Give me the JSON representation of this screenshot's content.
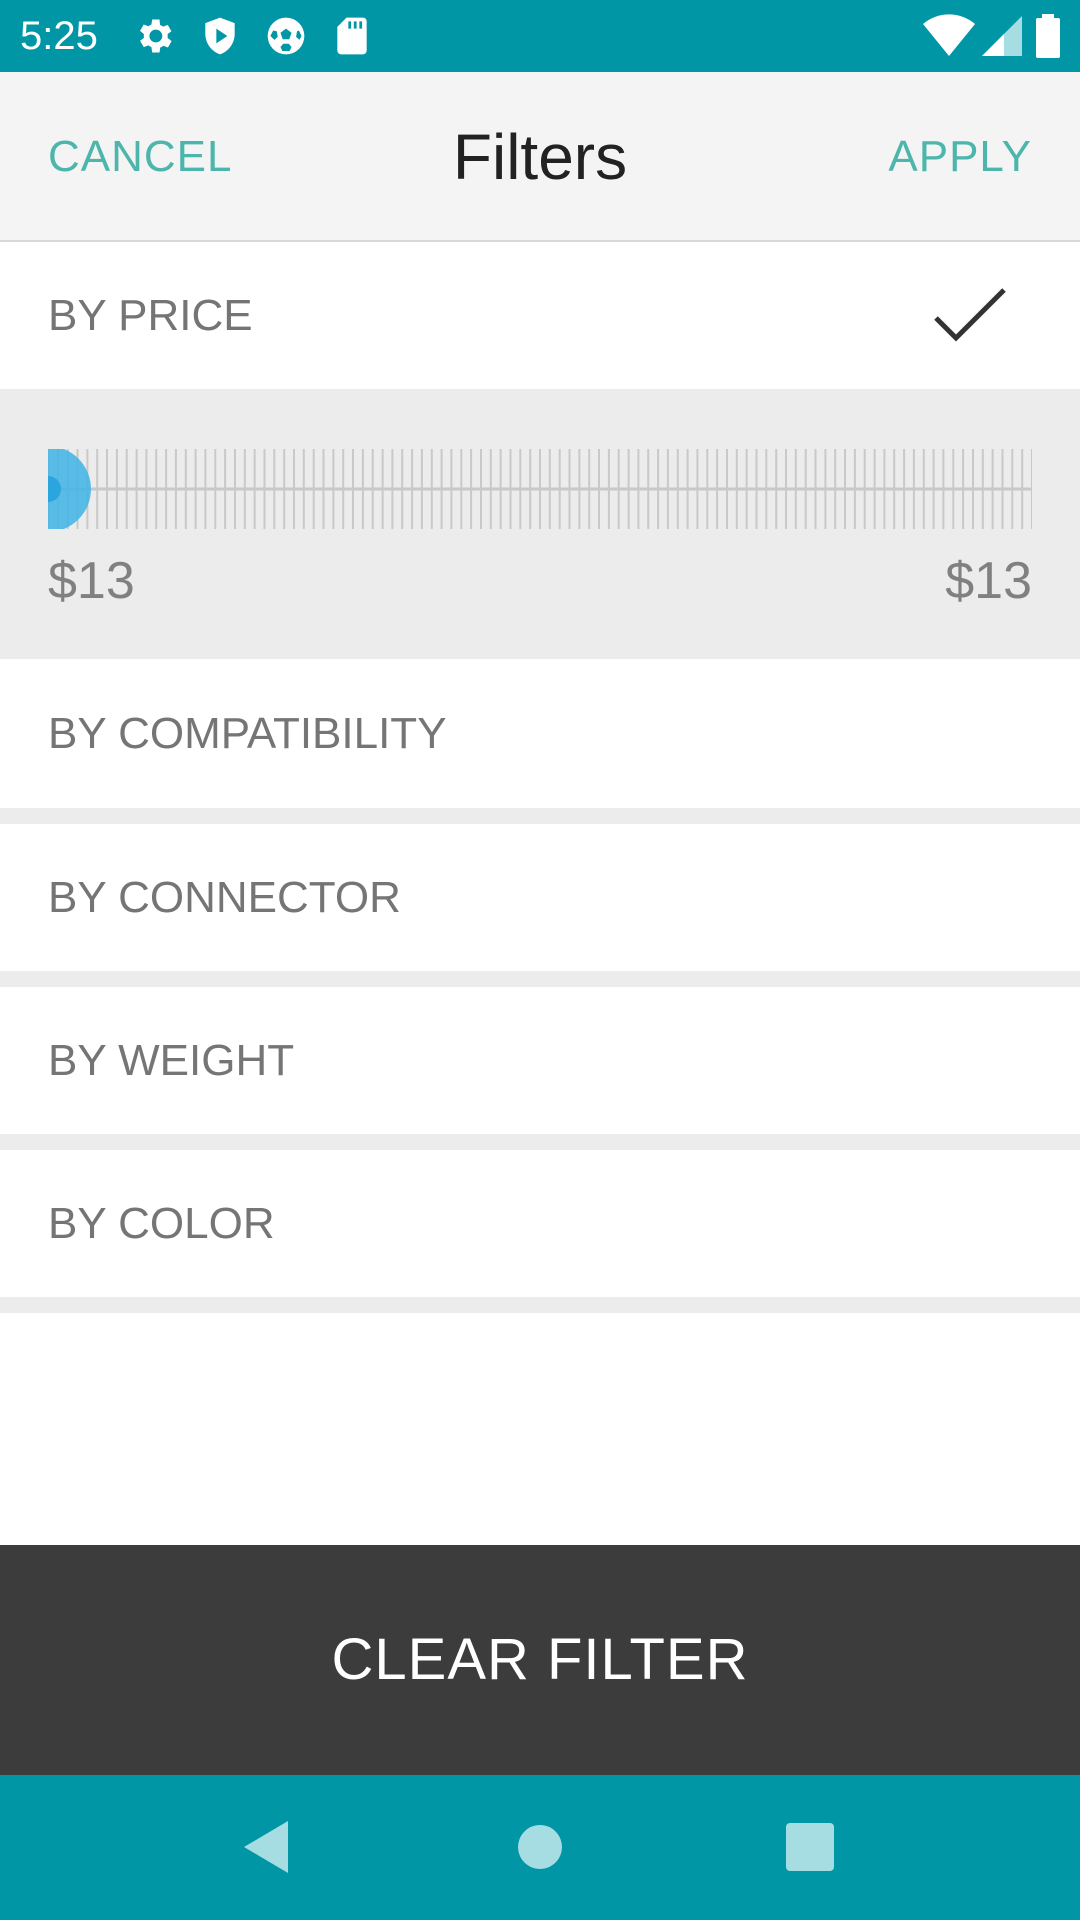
{
  "status_bar": {
    "time": "5:25",
    "left_icons": [
      "gear-icon",
      "shield-play-icon",
      "soccer-ball-icon",
      "sd-card-icon"
    ],
    "right_icons": [
      "wifi-icon",
      "signal-icon",
      "battery-icon"
    ]
  },
  "header": {
    "cancel_label": "CANCEL",
    "title": "Filters",
    "apply_label": "APPLY"
  },
  "filters": {
    "price": {
      "label": "BY PRICE",
      "checked": true,
      "min_label": "$13",
      "max_label": "$13",
      "slider_position": 0.0
    },
    "items": [
      {
        "label": "BY COMPATIBILITY"
      },
      {
        "label": "BY CONNECTOR"
      },
      {
        "label": "BY WEIGHT"
      },
      {
        "label": "BY COLOR"
      }
    ]
  },
  "clear_button_label": "CLEAR FILTER",
  "nav_bar": [
    "back-icon",
    "home-icon",
    "recents-icon"
  ],
  "colors": {
    "accent": "#0096a6",
    "header_action": "#4db6ac",
    "slider_thumb": "#3fb4e6",
    "clear_button_bg": "#3c3c3c"
  }
}
